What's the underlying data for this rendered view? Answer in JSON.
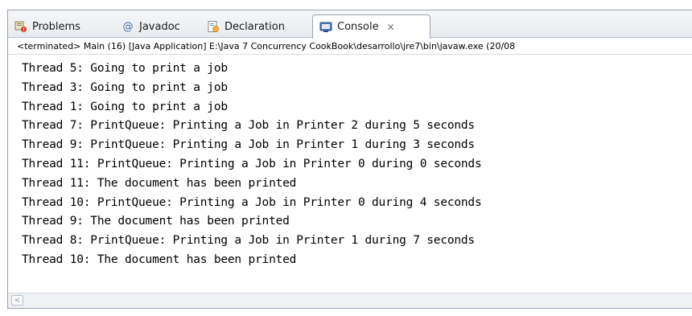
{
  "tabs": [
    {
      "label": "Problems",
      "icon": "problems-icon",
      "active": false
    },
    {
      "label": "Javadoc",
      "icon": "javadoc-icon",
      "active": false
    },
    {
      "label": "Declaration",
      "icon": "declaration-icon",
      "active": false
    },
    {
      "label": "Console",
      "icon": "console-icon",
      "active": true
    }
  ],
  "close_glyph": "✕",
  "status": "<terminated> Main (16) [Java Application] E:\\Java 7 Concurrency CookBook\\desarrollo\\jre7\\bin\\javaw.exe (20/08",
  "console_lines": [
    "Thread 5: Going to print a job",
    "Thread 3: Going to print a job",
    "Thread 1: Going to print a job",
    "Thread 7: PrintQueue: Printing a Job in Printer 2 during 5 seconds",
    "Thread 9: PrintQueue: Printing a Job in Printer 1 during 3 seconds",
    "Thread 11: PrintQueue: Printing a Job in Printer 0 during 0 seconds",
    "Thread 11: The document has been printed",
    "Thread 10: PrintQueue: Printing a Job in Printer 0 during 4 seconds",
    "Thread 9: The document has been printed",
    "Thread 8: PrintQueue: Printing a Job in Printer 1 during 7 seconds",
    "Thread 10: The document has been printed"
  ],
  "scroll_left_glyph": "<"
}
